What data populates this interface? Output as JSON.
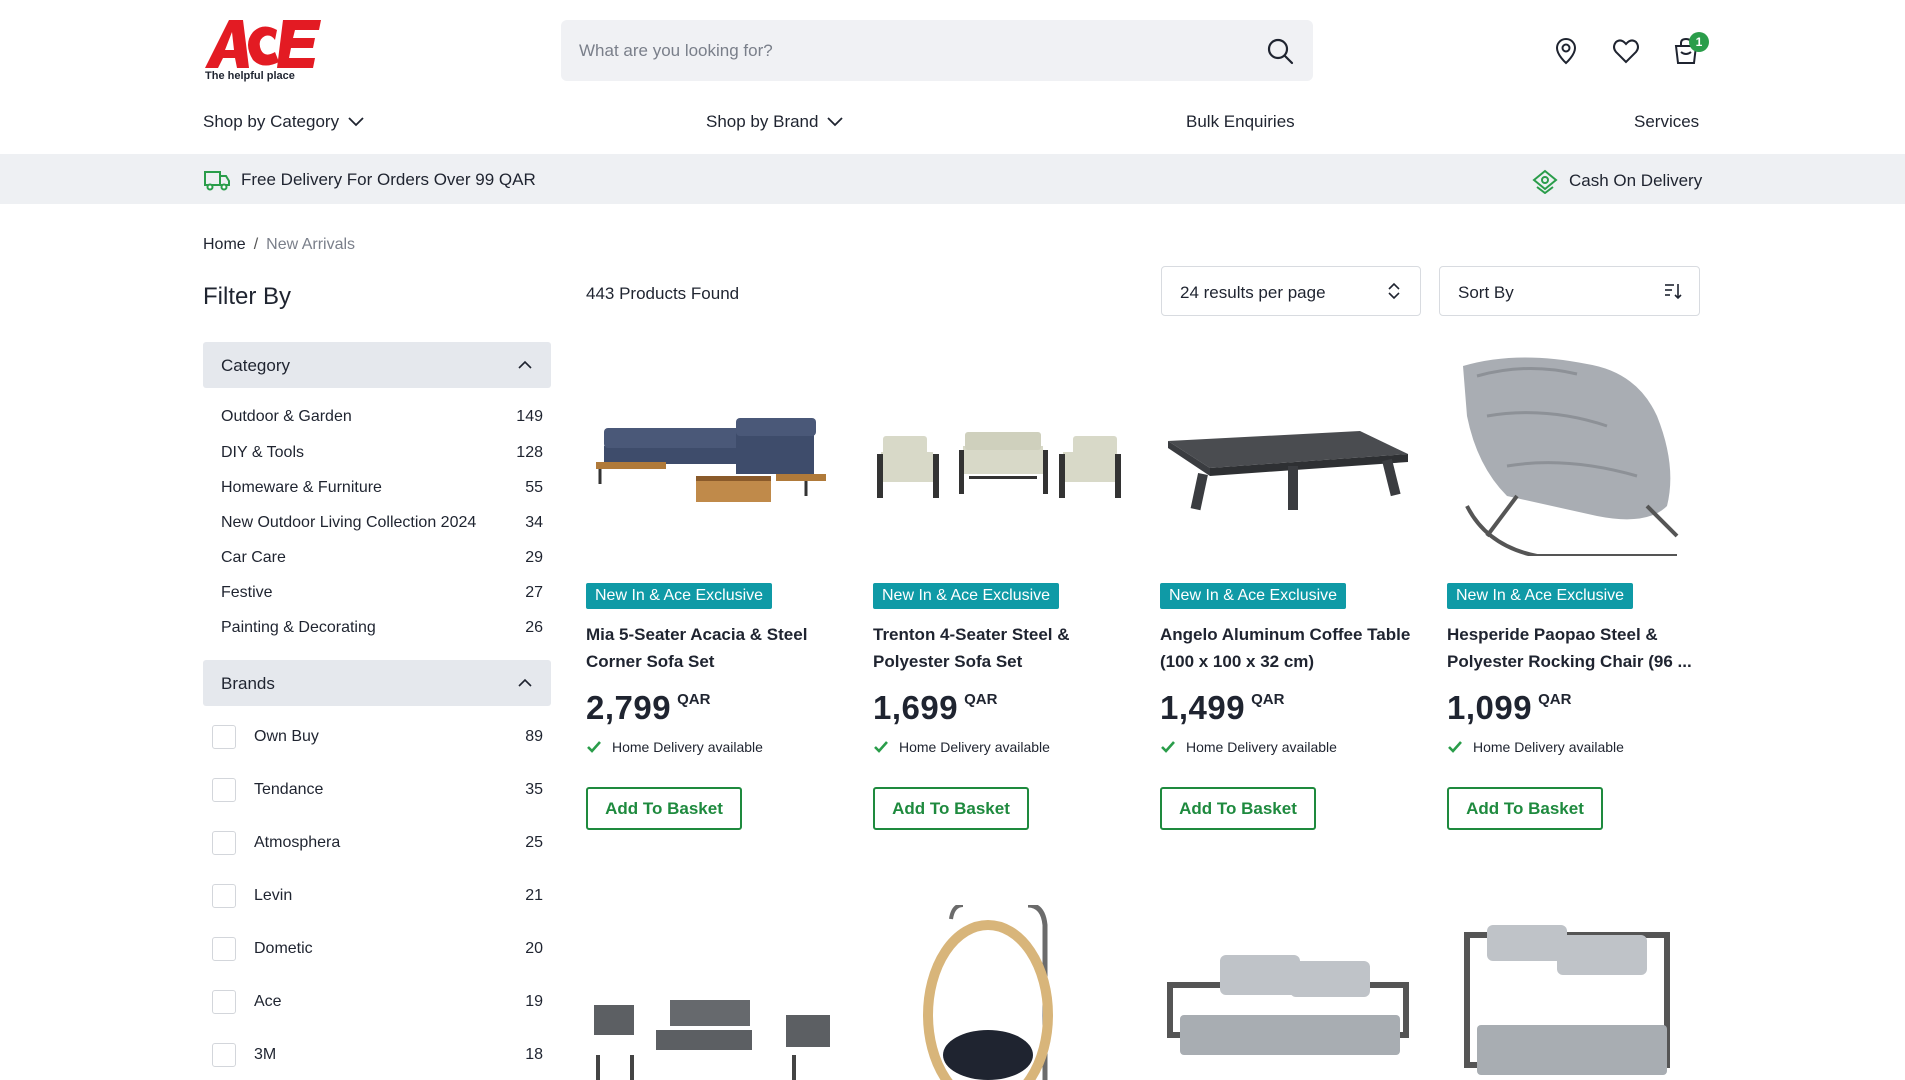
{
  "brand": {
    "logo_text": "ACE",
    "tagline": "The helpful place",
    "accent_color": "#e31b23"
  },
  "search": {
    "placeholder": "What are you looking for?"
  },
  "header_icons": {
    "location": "location-pin-icon",
    "wishlist": "heart-icon",
    "cart": "shopping-bag-icon",
    "cart_count": "1"
  },
  "nav": {
    "shop_by_category": "Shop by Category",
    "shop_by_brand": "Shop by Brand",
    "bulk": "Bulk Enquiries",
    "services": "Services"
  },
  "banner": {
    "delivery": "Free Delivery For Orders Over 99 QAR",
    "cod": "Cash On Delivery"
  },
  "breadcrumb": {
    "home": "Home",
    "sep": "/",
    "current": "New Arrivals"
  },
  "sidebar": {
    "title": "Filter By",
    "category_head": "Category",
    "categories": [
      {
        "label": "Outdoor & Garden",
        "count": "149"
      },
      {
        "label": "DIY & Tools",
        "count": "128"
      },
      {
        "label": "Homeware & Furniture",
        "count": "55"
      },
      {
        "label": "New Outdoor Living Collection 2024",
        "count": "34"
      },
      {
        "label": "Car Care",
        "count": "29"
      },
      {
        "label": "Festive",
        "count": "27"
      },
      {
        "label": "Painting & Decorating",
        "count": "26"
      }
    ],
    "brands_head": "Brands",
    "brands": [
      {
        "label": "Own Buy",
        "count": "89"
      },
      {
        "label": "Tendance",
        "count": "35"
      },
      {
        "label": "Atmosphera",
        "count": "25"
      },
      {
        "label": "Levin",
        "count": "21"
      },
      {
        "label": "Dometic",
        "count": "20"
      },
      {
        "label": "Ace",
        "count": "19"
      },
      {
        "label": "3M",
        "count": "18"
      }
    ]
  },
  "results": {
    "found": "443 Products Found",
    "per_page": "24 results per page",
    "sort": "Sort By"
  },
  "products": [
    {
      "tag": "New In & Ace Exclusive",
      "name": "Mia 5-Seater Acacia & Steel Corner Sofa Set",
      "price": "2,799",
      "currency": "QAR",
      "delivery": "Home Delivery available",
      "button": "Add To Basket"
    },
    {
      "tag": "New In & Ace Exclusive",
      "name": "Trenton 4-Seater Steel & Polyester Sofa Set",
      "price": "1,699",
      "currency": "QAR",
      "delivery": "Home Delivery available",
      "button": "Add To Basket"
    },
    {
      "tag": "New In & Ace Exclusive",
      "name": "Angelo Aluminum Coffee Table (100 x 100 x 32 cm)",
      "price": "1,499",
      "currency": "QAR",
      "delivery": "Home Delivery available",
      "button": "Add To Basket"
    },
    {
      "tag": "New In & Ace Exclusive",
      "name": "Hesperide Paopao Steel & Polyester Rocking Chair (96 ...",
      "price": "1,099",
      "currency": "QAR",
      "delivery": "Home Delivery available",
      "button": "Add To Basket"
    }
  ],
  "colors": {
    "tag_bg": "#0f9aa6",
    "button_green": "#1e8a3e",
    "check_green": "#2a9d4a"
  }
}
